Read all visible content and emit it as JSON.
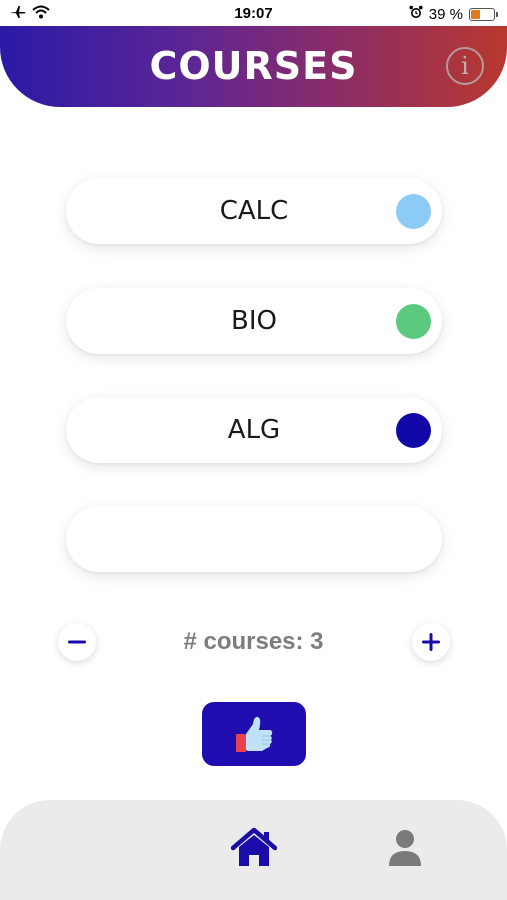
{
  "status_bar": {
    "time": "19:07",
    "battery_percent": "39 %",
    "battery_level": 0.39,
    "icons": [
      "airplane-icon",
      "wifi-icon",
      "alarm-icon",
      "battery-icon"
    ]
  },
  "header": {
    "title": "COURSES",
    "info_icon": "info-icon",
    "gradient": [
      "#2a1aa6",
      "#b8382e"
    ]
  },
  "courses": [
    {
      "label": "CALC",
      "color": "#8ccbf5"
    },
    {
      "label": "BIO",
      "color": "#5bc97e"
    },
    {
      "label": "ALG",
      "color": "#1208a8"
    },
    {
      "label": "",
      "color": ""
    }
  ],
  "counter": {
    "text": "# courses: 3",
    "minus_icon": "minus-icon",
    "plus_icon": "plus-icon"
  },
  "submit": {
    "icon": "thumbs-up-icon",
    "color": "#1f0db0"
  },
  "bottom_nav": {
    "items": [
      {
        "icon": "home-icon",
        "active": true,
        "color": "#1a0ca8"
      },
      {
        "icon": "user-icon",
        "active": false,
        "color": "#7a7a7a"
      }
    ]
  }
}
